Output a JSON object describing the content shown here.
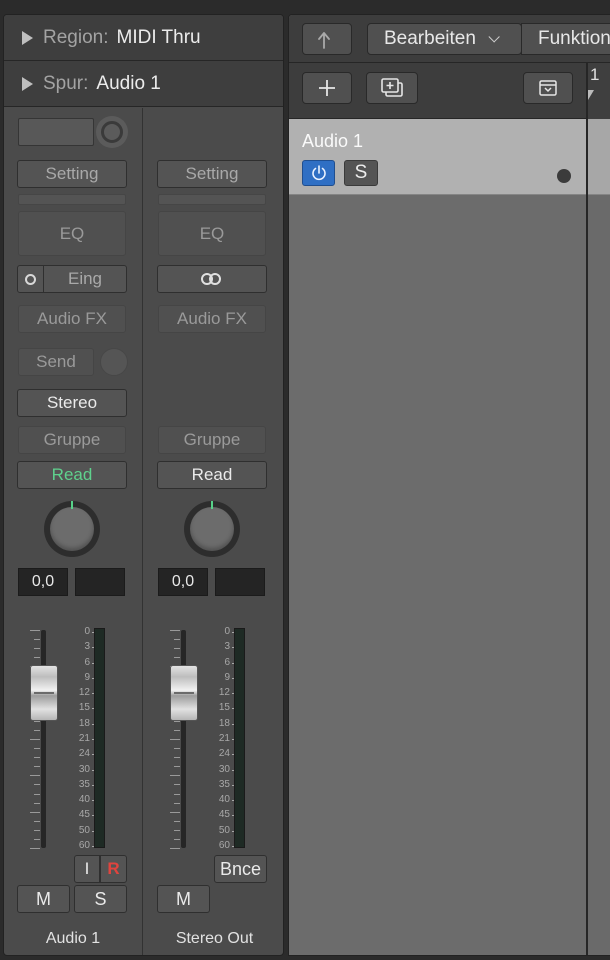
{
  "inspector": {
    "region": {
      "label": "Region:",
      "value": "MIDI Thru"
    },
    "track": {
      "label": "Spur:",
      "value": "Audio 1"
    }
  },
  "strips": [
    {
      "name": "Audio 1",
      "setting": "Setting",
      "eq": "EQ",
      "input": "Eing",
      "audio_fx": "Audio FX",
      "send": "Send",
      "output": "Stereo",
      "group": "Gruppe",
      "automation": "Read",
      "volume": "0,0",
      "input_monitor": "I",
      "record": "R",
      "mute": "M",
      "solo": "S"
    },
    {
      "name": "Stereo Out",
      "setting": "Setting",
      "eq": "EQ",
      "audio_fx": "Audio FX",
      "group": "Gruppe",
      "automation": "Read",
      "volume": "0,0",
      "bounce": "Bnce",
      "mute": "M"
    }
  ],
  "meter_scale": [
    "0",
    "3",
    "6",
    "9",
    "12",
    "15",
    "18",
    "21",
    "24",
    "30",
    "35",
    "40",
    "45",
    "50",
    "60"
  ],
  "tracks_area": {
    "menu_edit": "Bearbeiten",
    "menu_functions": "Funktionen",
    "ruler_bar": "1",
    "track": {
      "name": "Audio 1",
      "solo": "S"
    }
  },
  "colors": {
    "read_active": "#5fd18d",
    "record": "#e0443e",
    "power_blue": "#2f6fc4",
    "pan_indicator": "#58d28a"
  },
  "icons": {
    "back": "back-arrow-icon",
    "add": "plus-icon",
    "duplicate": "duplicate-track-icon",
    "filter": "filter-icon",
    "power": "power-icon",
    "stereo": "stereo-link-icon"
  }
}
